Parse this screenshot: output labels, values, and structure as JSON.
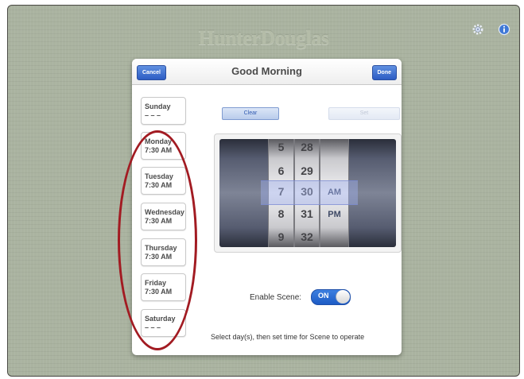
{
  "brand": "HunterDouglas",
  "top_bar": {
    "gear_icon": "gear-icon",
    "info_icon": "info-icon"
  },
  "dialog": {
    "title": "Good Morning",
    "cancel_label": "Cancel",
    "done_label": "Done"
  },
  "days": [
    {
      "name": "Sunday",
      "time": "– – –"
    },
    {
      "name": "Monday",
      "time": "7:30 AM"
    },
    {
      "name": "Tuesday",
      "time": "7:30 AM"
    },
    {
      "name": "Wednesday",
      "time": "7:30 AM"
    },
    {
      "name": "Thursday",
      "time": "7:30 AM"
    },
    {
      "name": "Friday",
      "time": "7:30 AM"
    },
    {
      "name": "Saturday",
      "time": "– – –"
    }
  ],
  "actions": {
    "clear_label": "Clear",
    "set_label": "Set"
  },
  "picker": {
    "hours": [
      "5",
      "6",
      "7",
      "8",
      "9"
    ],
    "minutes": [
      "28",
      "29",
      "30",
      "31",
      "32"
    ],
    "period": [
      "AM",
      "PM"
    ],
    "selected": {
      "hour": "7",
      "minute": "30",
      "period": "AM"
    }
  },
  "scene": {
    "enable_label": "Enable Scene:",
    "toggle_state": "ON",
    "hint": "Select day(s), then set time for Scene to operate"
  },
  "colors": {
    "accent": "#2d5cc4",
    "highlight_ring": "#a21b22"
  }
}
